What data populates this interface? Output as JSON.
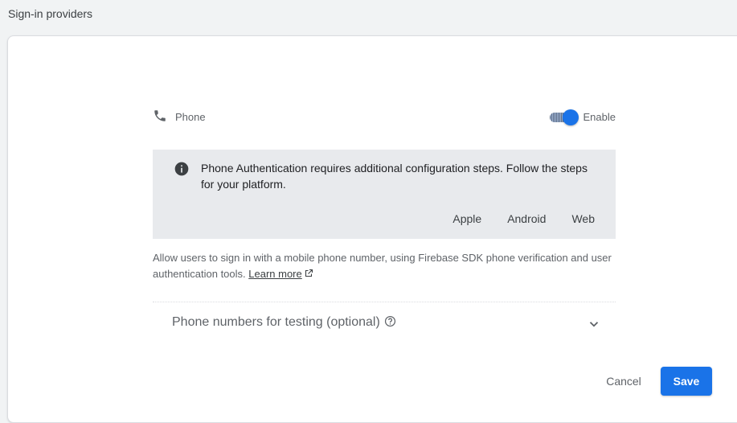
{
  "header": {
    "title": "Sign-in providers"
  },
  "provider": {
    "name": "Phone",
    "icon": "phone-icon",
    "enabled": true,
    "enable_label": "Enable"
  },
  "info": {
    "icon": "info-icon",
    "message": "Phone Authentication requires additional configuration steps. Follow the steps for your platform.",
    "platforms": [
      "Apple",
      "Android",
      "Web"
    ]
  },
  "description": {
    "text": "Allow users to sign in with a mobile phone number, using Firebase SDK phone verification and user authentication tools.",
    "link_label": "Learn more"
  },
  "testing_section": {
    "label": "Phone numbers for testing (optional)",
    "expanded": false
  },
  "actions": {
    "cancel_label": "Cancel",
    "save_label": "Save"
  },
  "colors": {
    "accent": "#1a73e8",
    "info_background": "#e8eaed",
    "page_background": "#f1f3f4"
  }
}
